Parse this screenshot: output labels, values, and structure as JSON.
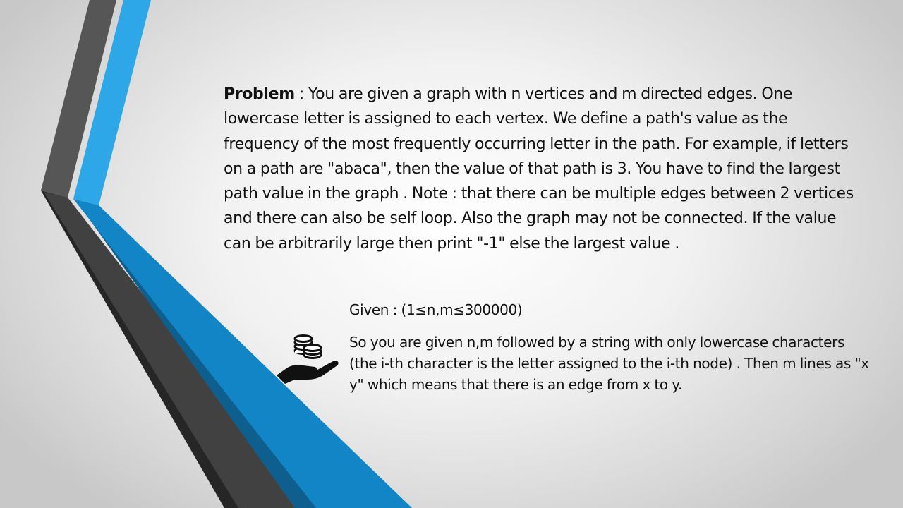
{
  "slide": {
    "problem": {
      "label": "Problem",
      "text": " :  You are given a graph with n vertices and m directed edges. One lowercase letter is assigned to each vertex. We define a path's value as the frequency of the most frequently occurring letter in the path. For example, if letters on a path are \"abaca\", then the value of that path is 3. You have to find the largest path value in the graph . Note :  that there can be multiple edges between 2 vertices and there can also be self loop. Also the graph may not be connected. If the value can be arbitrarily large then print \"-1\" else the largest value ."
    },
    "given": {
      "constraint": "Given : (1≤n,m≤300000)",
      "description": "So you are given n,m followed by a string with only lowercase characters (the i-th character is the letter assigned to the i-th node) . Then m lines as \"x y\" which means that there is an edge from x to y."
    },
    "icon": "hand-with-coins-icon",
    "colors": {
      "dark_gray_stripe": "#565656",
      "light_blue_stripe": "#2ea7e8",
      "dark_stripe": "#3d3d3d",
      "blue_band": "#1285c6",
      "text": "#111111"
    }
  }
}
